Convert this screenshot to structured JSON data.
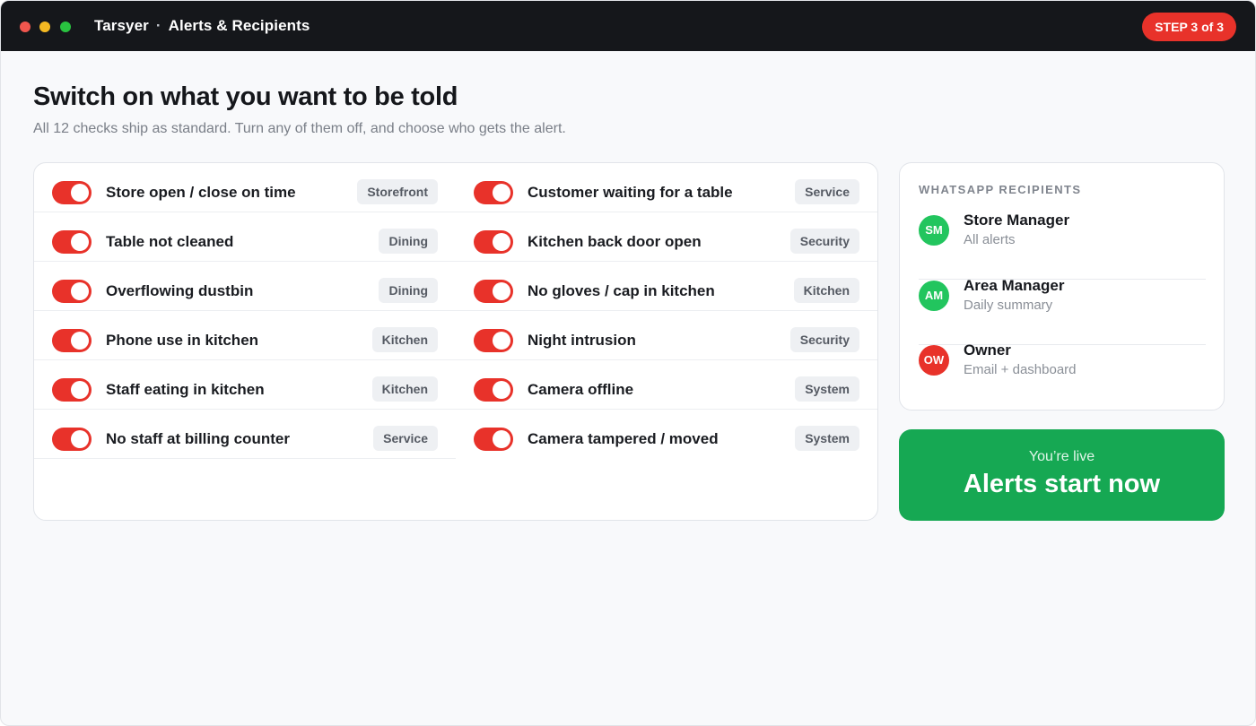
{
  "window": {
    "app_name": "Tarsyer",
    "separator": "·",
    "screen_name": "Alerts & Recipients",
    "step_badge": "STEP 3 of 3"
  },
  "header": {
    "title": "Switch on what you want to be told",
    "subtitle": "All 12 checks ship as standard. Turn any of them off, and choose who gets the alert."
  },
  "checks": {
    "left": [
      {
        "label": "Store open / close on time",
        "tag": "Storefront",
        "enabled": true
      },
      {
        "label": "Table not cleaned",
        "tag": "Dining",
        "enabled": true
      },
      {
        "label": "Overflowing dustbin",
        "tag": "Dining",
        "enabled": true
      },
      {
        "label": "Phone use in kitchen",
        "tag": "Kitchen",
        "enabled": true
      },
      {
        "label": "Staff eating in kitchen",
        "tag": "Kitchen",
        "enabled": true
      },
      {
        "label": "No staff at billing counter",
        "tag": "Service",
        "enabled": true
      }
    ],
    "right": [
      {
        "label": "Customer waiting for a table",
        "tag": "Service",
        "enabled": true
      },
      {
        "label": "Kitchen back door open",
        "tag": "Security",
        "enabled": true
      },
      {
        "label": "No gloves / cap in kitchen",
        "tag": "Kitchen",
        "enabled": true
      },
      {
        "label": "Night intrusion",
        "tag": "Security",
        "enabled": true
      },
      {
        "label": "Camera offline",
        "tag": "System",
        "enabled": true
      },
      {
        "label": "Camera tampered / moved",
        "tag": "System",
        "enabled": true
      }
    ]
  },
  "recipients": {
    "heading": "WHATSAPP RECIPIENTS",
    "items": [
      {
        "initials": "SM",
        "name": "Store Manager",
        "desc": "All alerts",
        "color": "#22c55e"
      },
      {
        "initials": "AM",
        "name": "Area Manager",
        "desc": "Daily summary",
        "color": "#22c55e"
      },
      {
        "initials": "OW",
        "name": "Owner",
        "desc": "Email + dashboard",
        "color": "#e8322a"
      }
    ]
  },
  "live": {
    "kicker": "You’re live",
    "title": "Alerts start now"
  },
  "colors": {
    "accent_red": "#e8322a",
    "success_green": "#16a853",
    "titlebar": "#15171b"
  }
}
